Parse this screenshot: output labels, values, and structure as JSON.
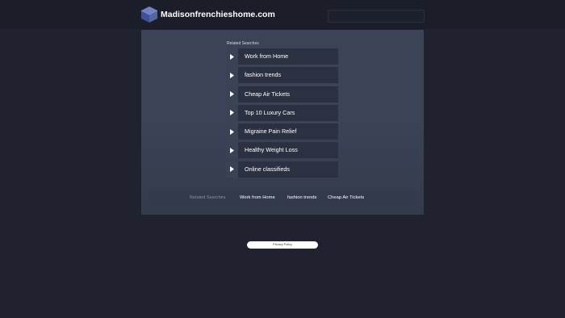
{
  "site": {
    "title": "Madisonfrenchieshome.com",
    "logo_icon": "cube-icon"
  },
  "search": {
    "placeholder": ""
  },
  "main": {
    "heading": "Related Searches",
    "items": [
      {
        "label": "Work from Home"
      },
      {
        "label": "fashion trends"
      },
      {
        "label": "Cheap Air Tickets"
      },
      {
        "label": "Top 10 Luxury Cars"
      },
      {
        "label": "Migraine Pain Relief"
      },
      {
        "label": "Healthy Weight Loss"
      },
      {
        "label": "Online classifieds"
      }
    ]
  },
  "bottom": {
    "heading": "Related Searches",
    "links": [
      {
        "label": "Work from Home"
      },
      {
        "label": "fashion trends"
      },
      {
        "label": "Cheap Air Tickets"
      }
    ]
  },
  "footer": {
    "privacy_label": "Privacy Policy"
  },
  "colors": {
    "page_bg": "#20232f",
    "panel_bg": "#3b4457",
    "link_bg": "#2b3140",
    "accent": "#ffffff"
  }
}
